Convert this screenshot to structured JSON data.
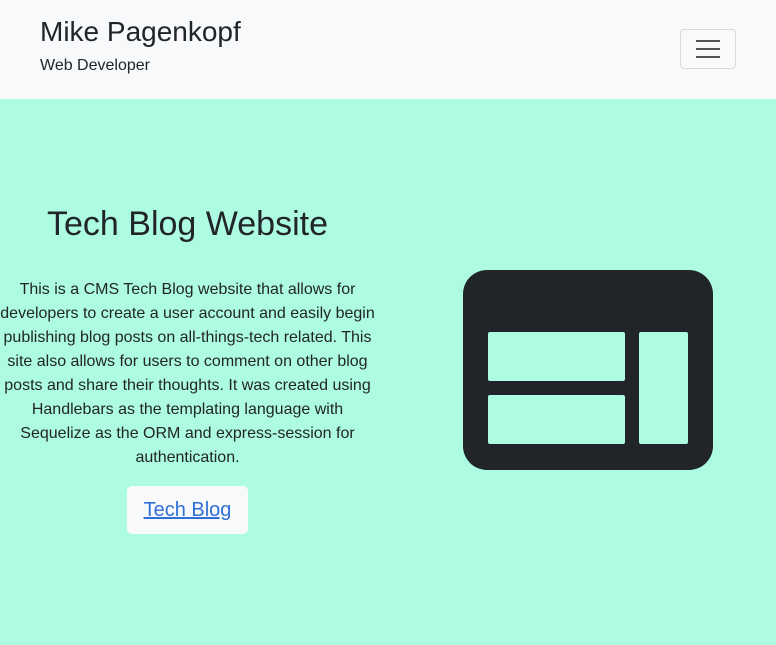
{
  "header": {
    "name": "Mike Pagenkopf",
    "subtitle": "Web Developer",
    "menu_icon": "hamburger-menu-icon"
  },
  "project": {
    "title": "Tech Blog Website",
    "description": "This is a CMS Tech Blog website that allows for developers to create a user account and easily begin publishing blog posts on all-things-tech related. This site also allows for users to comment on other blog posts and share their thoughts. It was created using Handlebars as the templating language with Sequelize as the ORM and express-session for authentication.",
    "link_label": "Tech Blog",
    "icon": "browser-layout-icon"
  },
  "colors": {
    "navbar_bg": "#f8f9fa",
    "hero_bg": "#adfbe0",
    "text": "#212529",
    "link": "#2f6fd6",
    "icon": "#212529"
  }
}
